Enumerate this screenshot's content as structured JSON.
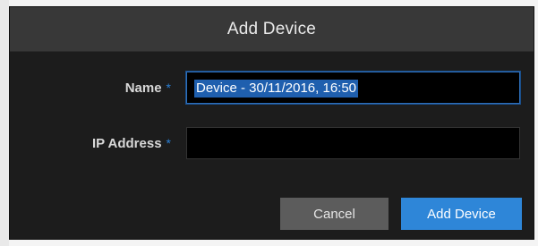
{
  "dialog": {
    "title": "Add Device"
  },
  "form": {
    "name": {
      "label": "Name",
      "required_marker": "*",
      "value": "Device - 30/11/2016, 16:50"
    },
    "ip_address": {
      "label": "IP Address",
      "required_marker": "*",
      "value": ""
    }
  },
  "buttons": {
    "cancel_label": "Cancel",
    "add_label": "Add Device"
  },
  "colors": {
    "accent": "#2e86d8",
    "required_marker": "#2a7fd4",
    "dialog_background": "#1c1c1c",
    "header_background": "#383838",
    "cancel_button": "#5c5c5c"
  }
}
